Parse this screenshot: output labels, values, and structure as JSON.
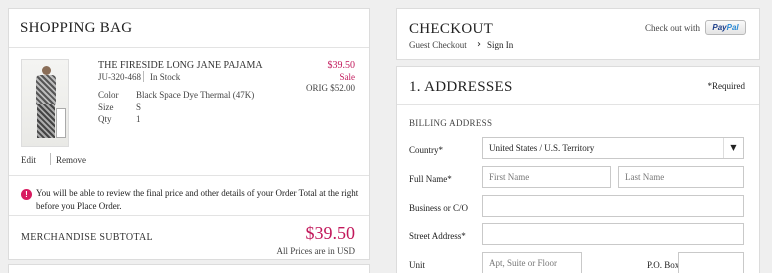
{
  "bag": {
    "title": "Shopping Bag",
    "item": {
      "name": "THE FIRESIDE LONG JANE PAJAMA",
      "sku": "JU-320-468",
      "stock": "In Stock",
      "price": "$39.50",
      "sale_label": "Sale",
      "orig_price": "ORIG $52.00",
      "attributes": [
        {
          "key": "Color",
          "value": "Black Space Dye Thermal (47K)"
        },
        {
          "key": "Size",
          "value": "S"
        },
        {
          "key": "Qty",
          "value": "1"
        }
      ],
      "edit_label": "Edit",
      "remove_label": "Remove"
    },
    "notice": "You will be able to review the final price and other details of your Order Total at the right before you Place Order.",
    "subtotal_label": "MERCHANDISE SUBTOTAL",
    "subtotal_value": "$39.50",
    "subtotal_note": "All Prices are in USD"
  },
  "checkout": {
    "title": "Checkout",
    "guest_label": "Guest Checkout",
    "signin_label": "Sign In",
    "paypal_label": "Check out with",
    "paypal_word_1": "Pay",
    "paypal_word_2": "Pal"
  },
  "addresses": {
    "title": "1. Addresses",
    "required_note": "*Required",
    "billing_title": "BILLING ADDRESS",
    "country_label": "Country*",
    "country_value": "United States / U.S. Territory",
    "fullname_label": "Full Name*",
    "first_name_placeholder": "First Name",
    "last_name_placeholder": "Last Name",
    "business_label": "Business or C/O",
    "street_label": "Street Address*",
    "unit_label": "Unit",
    "unit_placeholder": "Apt, Suite or Floor",
    "pobox_label": "P.O. Box"
  },
  "colors": {
    "accent": "#c2185b",
    "notice_icon": "#d81b60",
    "panel_border": "#dcdcdc",
    "page_bg": "#efefef"
  },
  "icons": {
    "notice": "exclamation-circle-icon",
    "signin": "chevron-right-icon",
    "country_select": "chevron-down-icon"
  }
}
